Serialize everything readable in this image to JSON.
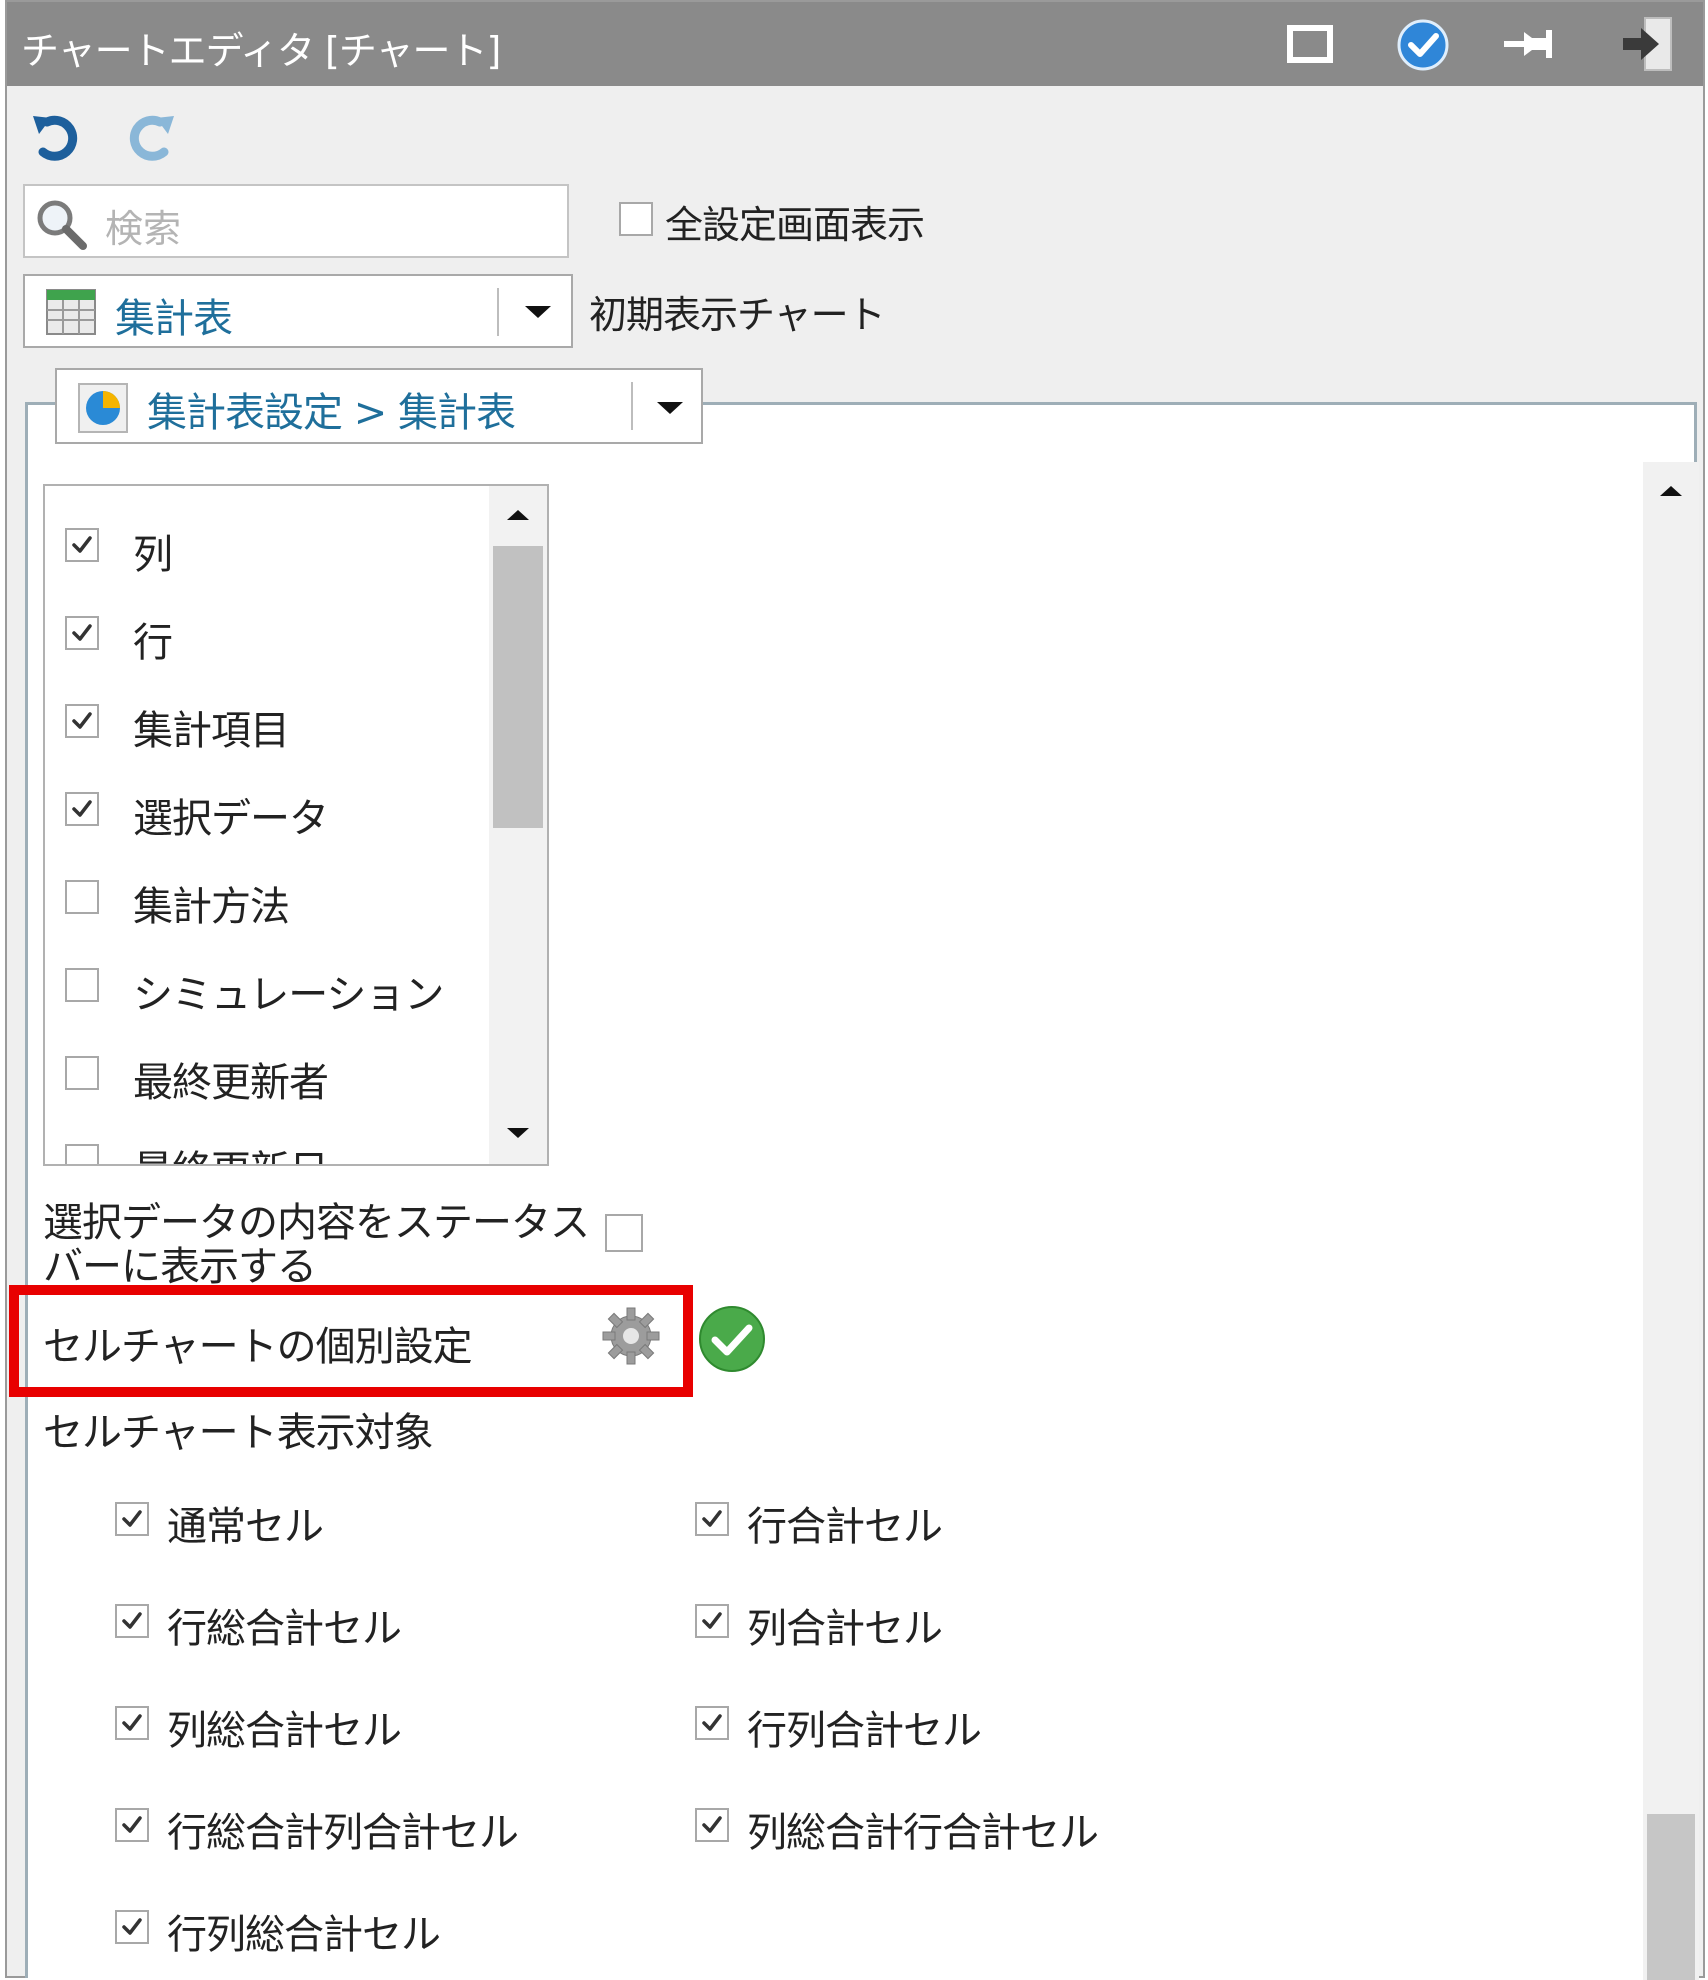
{
  "window": {
    "title": "チャートエディタ [チャート]",
    "buttons": [
      "maximize-icon",
      "apply-check-icon",
      "pin-icon",
      "exit-icon"
    ]
  },
  "toolbar": {
    "undo": "undo-icon",
    "redo": "redo-icon"
  },
  "search": {
    "placeholder": "検索"
  },
  "show_all_settings": {
    "label": "全設定画面表示",
    "checked": false
  },
  "chart_select": {
    "value": "集計表",
    "side_label": "初期表示チャート"
  },
  "settings_select": {
    "value": "集計表設定 > 集計表"
  },
  "display_items": {
    "items": [
      {
        "label": "列",
        "checked": true
      },
      {
        "label": "行",
        "checked": true
      },
      {
        "label": "集計項目",
        "checked": true
      },
      {
        "label": "選択データ",
        "checked": true
      },
      {
        "label": "集計方法",
        "checked": false
      },
      {
        "label": "シミュレーション",
        "checked": false
      },
      {
        "label": "最終更新者",
        "checked": false
      },
      {
        "label": "最終更新日",
        "checked": false
      }
    ]
  },
  "status_bar_option": {
    "label_line1": "選択データの内容をステータス",
    "label_line2": "バーに表示する",
    "checked": false
  },
  "cell_chart_individual": {
    "label": "セルチャートの個別設定"
  },
  "cell_chart_targets": {
    "heading": "セルチャート表示対象",
    "left": [
      {
        "label": "通常セル",
        "checked": true
      },
      {
        "label": "行総合計セル",
        "checked": true
      },
      {
        "label": "列総合計セル",
        "checked": true
      },
      {
        "label": "行総合計列合計セル",
        "checked": true
      },
      {
        "label": "行列総合計セル",
        "checked": true
      }
    ],
    "right": [
      {
        "label": "行合計セル",
        "checked": true
      },
      {
        "label": "列合計セル",
        "checked": true
      },
      {
        "label": "行列合計セル",
        "checked": true
      },
      {
        "label": "列総合計行合計セル",
        "checked": true
      }
    ]
  },
  "colors": {
    "titlebar": "#8a8a8a",
    "highlight": "#e80000",
    "link_text": "#1f6f9b"
  }
}
